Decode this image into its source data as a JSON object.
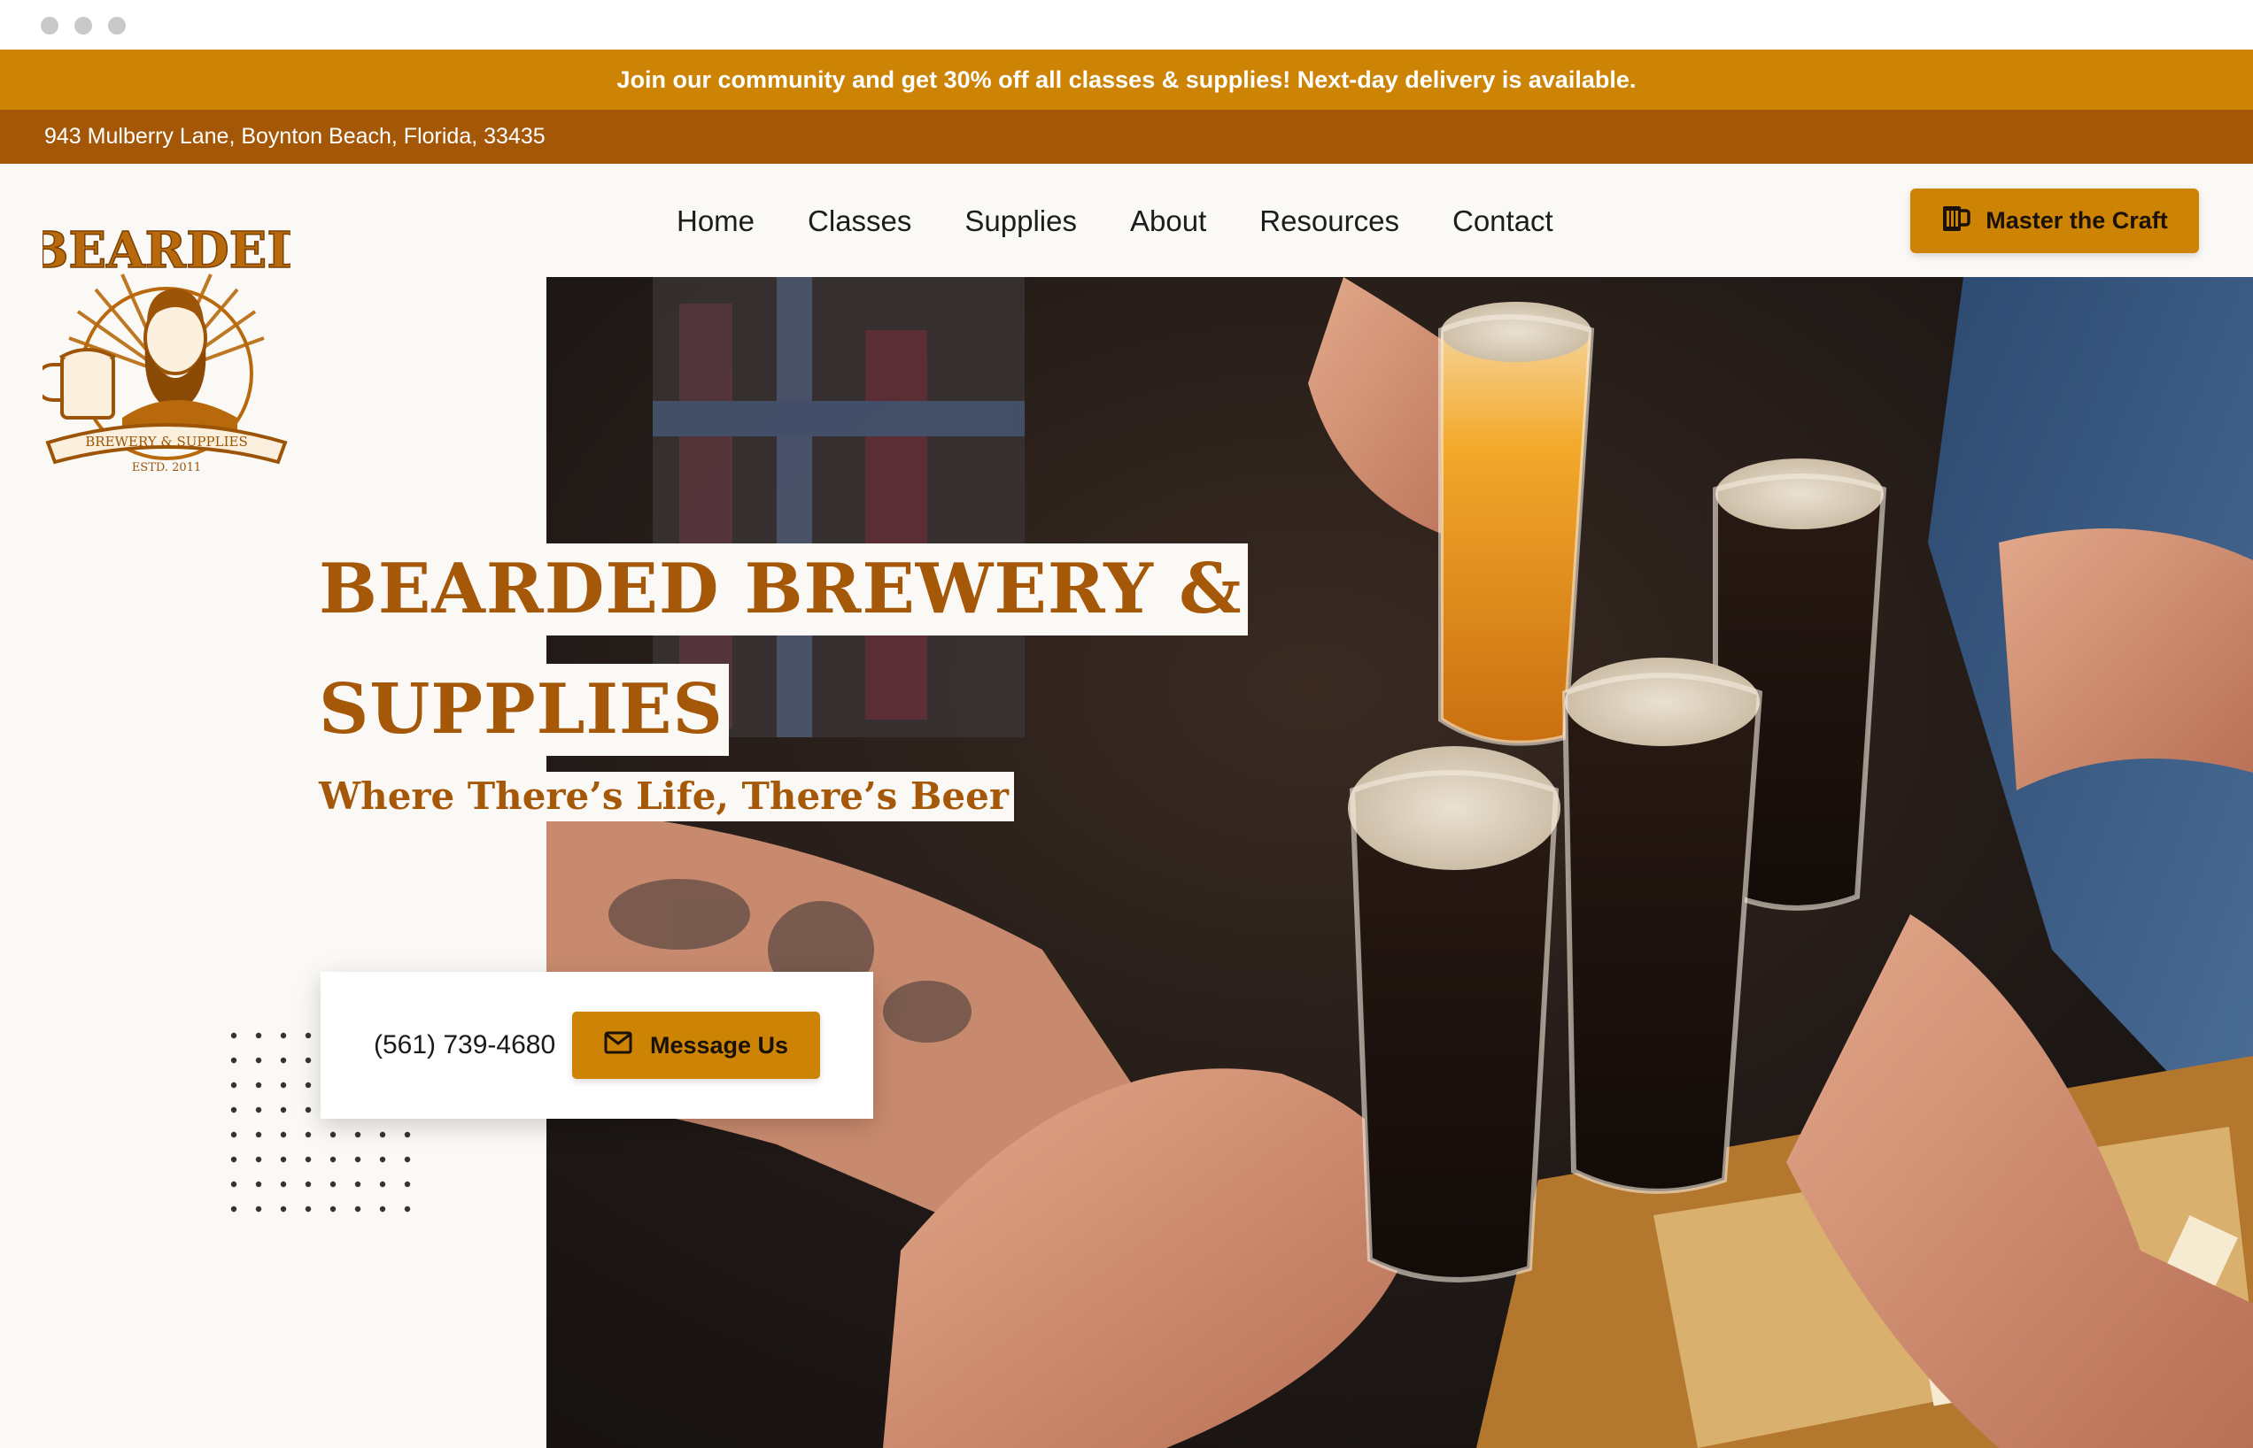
{
  "theme": {
    "promo_bg": "#cd8304",
    "address_bg": "#a45707",
    "accent": "#cd8304",
    "title_color": "#a55808",
    "page_bg": "#fbf9f6"
  },
  "promo": {
    "text": "Join our community and get 30% off all classes & supplies! Next-day delivery is available."
  },
  "address": {
    "text": "943 Mulberry Lane, Boynton Beach, Florida, 33435"
  },
  "nav": {
    "items": [
      {
        "label": "Home"
      },
      {
        "label": "Classes"
      },
      {
        "label": "Supplies"
      },
      {
        "label": "About"
      },
      {
        "label": "Resources"
      },
      {
        "label": "Contact"
      }
    ]
  },
  "header_cta": {
    "label": "Master the Craft",
    "icon": "beer-mug-icon"
  },
  "logo": {
    "wordmark": "BEARDED",
    "ribbon": "BREWERY & SUPPLIES",
    "established": "ESTD. 2011"
  },
  "hero": {
    "title_line1": "BEARDED BREWERY &",
    "title_line2": "SUPPLIES",
    "tagline": "Where There’s Life, There’s Beer",
    "image_description_icon": "beer-toast-photo"
  },
  "contact": {
    "phone": "(561) 739-4680",
    "message_label": "Message Us",
    "message_icon": "envelope-icon"
  }
}
